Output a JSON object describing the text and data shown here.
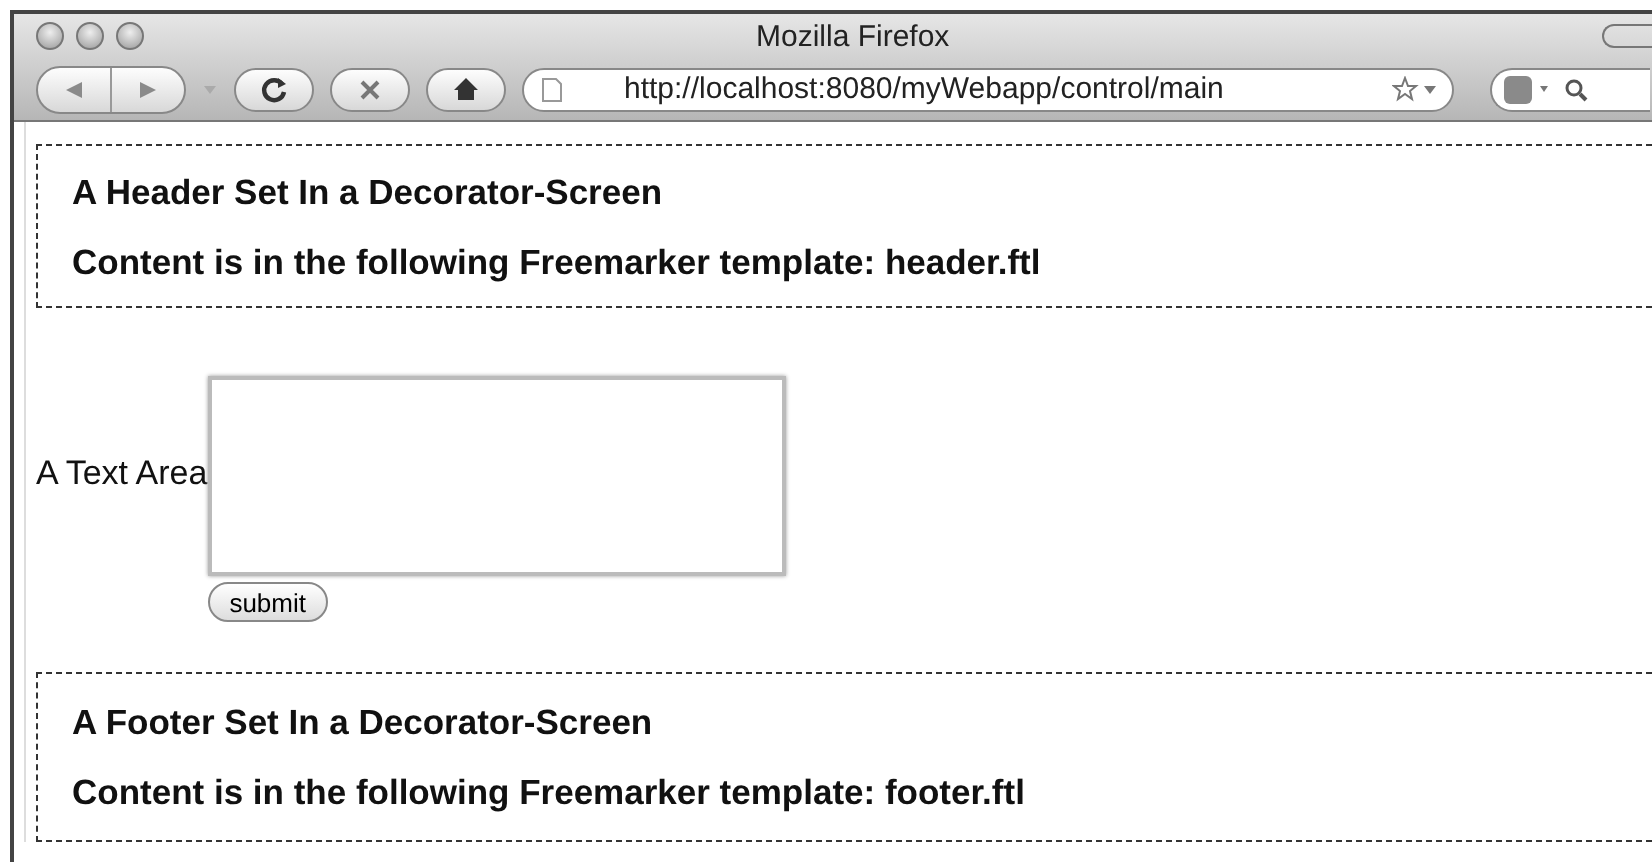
{
  "window": {
    "title": "Mozilla Firefox"
  },
  "toolbar": {
    "url": "http://localhost:8080/myWebapp/control/main"
  },
  "header": {
    "lines": [
      "A Header Set In a Decorator-Screen",
      "Content is in the following Freemarker template: header.ftl"
    ]
  },
  "form": {
    "label": "A Text Area",
    "submit": "submit"
  },
  "footer": {
    "lines": [
      "A Footer Set In a Decorator-Screen",
      "Content is in the following Freemarker template: footer.ftl"
    ]
  }
}
